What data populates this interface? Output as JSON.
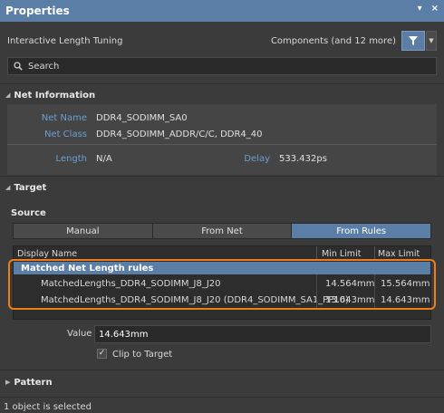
{
  "titlebar": {
    "title": "Properties",
    "pin_glyph": "▾",
    "close_glyph": "×"
  },
  "filter": {
    "mode_label": "Interactive Length Tuning",
    "components_label": "Components (and 12 more)"
  },
  "search": {
    "placeholder": "Search"
  },
  "net_info": {
    "header": "Net Information",
    "net_name_label": "Net Name",
    "net_name": "DDR4_SODIMM_SA0",
    "net_class_label": "Net Class",
    "net_class": "DDR4_SODIMM_ADDR/C/C, DDR4_40",
    "length_label": "Length",
    "length": "N/A",
    "delay_label": "Delay",
    "delay": "533.432ps"
  },
  "target": {
    "header": "Target",
    "source_label": "Source",
    "source_options": [
      "Manual",
      "From Net",
      "From Rules"
    ],
    "selected_source": "From Rules",
    "columns": [
      "Display Name",
      "Min Limit",
      "Max Limit"
    ],
    "group": "Matched Net Length rules",
    "rows": [
      {
        "name": "MatchedLengths_DDR4_SODIMM_J8_J20",
        "min": "14.564mm",
        "max": "15.564mm"
      },
      {
        "name": "MatchedLengths_DDR4_SODIMM_J8_J20 (DDR4_SODIMM_SA1_PP10)",
        "min": "13.643mm",
        "max": "14.643mm"
      }
    ],
    "value_label": "Value",
    "value": "14.643mm",
    "clip_label": "Clip to Target",
    "clip_checked": "✓"
  },
  "pattern": {
    "header": "Pattern"
  },
  "status": {
    "text": "1 object is selected"
  },
  "icons": {
    "filter": "funnel-icon",
    "search": "search-icon",
    "dropdown": "chevron-down-icon"
  },
  "colors": {
    "accent": "#5a7ea6",
    "highlight": "#f07d14",
    "label": "#6d9ed3"
  }
}
